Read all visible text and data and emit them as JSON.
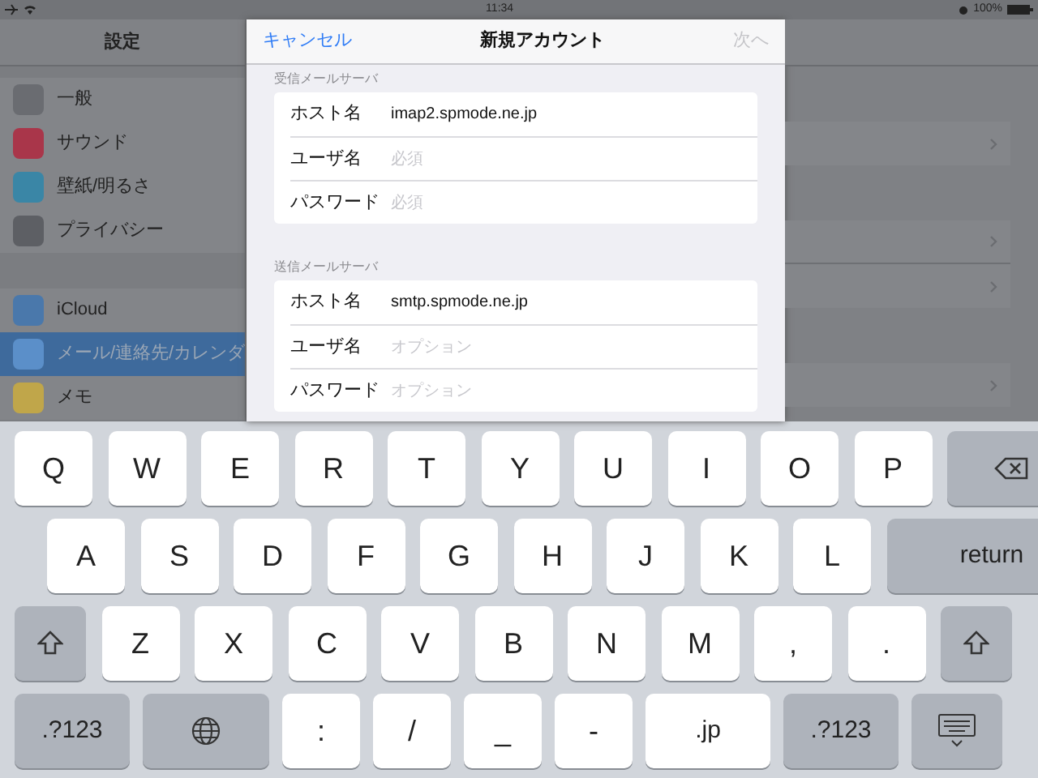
{
  "status_bar": {
    "time": "11:34",
    "battery": "100%"
  },
  "sidebar": {
    "title": "設定",
    "groups": [
      {
        "items": [
          {
            "label": "一般",
            "color": "#6a6c71",
            "selected": false
          },
          {
            "label": "サウンド",
            "color": "#a9364a",
            "selected": false
          },
          {
            "label": "壁紙/明るさ",
            "color": "#3a86a6",
            "selected": false
          },
          {
            "label": "プライバシー",
            "color": "#5d5f64",
            "selected": false
          }
        ]
      },
      {
        "items": [
          {
            "label": "iCloud",
            "color": "#4a78ab",
            "selected": false
          },
          {
            "label": "メール/連絡先/カレンダ",
            "color": "#5b8fc9",
            "selected": true
          },
          {
            "label": "メモ",
            "color": "#c0a64a",
            "selected": false
          }
        ]
      }
    ]
  },
  "dialog": {
    "cancel": "キャンセル",
    "title": "新規アカウント",
    "next": {
      "label": "次へ",
      "disabled": true
    },
    "sections": [
      {
        "header": "受信メールサーバ",
        "rows": [
          {
            "label": "ホスト名",
            "value": "imap2.spmode.ne.jp"
          },
          {
            "label": "ユーザ名",
            "placeholder": "必須"
          },
          {
            "label": "パスワード",
            "placeholder": "必須"
          }
        ]
      },
      {
        "header": "送信メールサーバ",
        "rows": [
          {
            "label": "ホスト名",
            "value": "smtp.spmode.ne.jp"
          },
          {
            "label": "ユーザ名",
            "placeholder": "オプション"
          },
          {
            "label": "パスワード",
            "placeholder": "オプション"
          }
        ]
      }
    ]
  },
  "keyboard": {
    "rows": [
      {
        "keys": [
          {
            "kind": "letter",
            "label": "Q"
          },
          {
            "kind": "letter",
            "label": "W"
          },
          {
            "kind": "letter",
            "label": "E"
          },
          {
            "kind": "letter",
            "label": "R"
          },
          {
            "kind": "letter",
            "label": "T"
          },
          {
            "kind": "letter",
            "label": "Y"
          },
          {
            "kind": "letter",
            "label": "U"
          },
          {
            "kind": "letter",
            "label": "I"
          },
          {
            "kind": "letter",
            "label": "O"
          },
          {
            "kind": "letter",
            "label": "P"
          },
          {
            "kind": "backspace"
          }
        ]
      },
      {
        "keys": [
          {
            "kind": "letter",
            "label": "A"
          },
          {
            "kind": "letter",
            "label": "S"
          },
          {
            "kind": "letter",
            "label": "D"
          },
          {
            "kind": "letter",
            "label": "F"
          },
          {
            "kind": "letter",
            "label": "G"
          },
          {
            "kind": "letter",
            "label": "H"
          },
          {
            "kind": "letter",
            "label": "J"
          },
          {
            "kind": "letter",
            "label": "K"
          },
          {
            "kind": "letter",
            "label": "L"
          },
          {
            "kind": "return",
            "label": "return"
          }
        ]
      },
      {
        "keys": [
          {
            "kind": "shift"
          },
          {
            "kind": "letter",
            "label": "Z"
          },
          {
            "kind": "letter",
            "label": "X"
          },
          {
            "kind": "letter",
            "label": "C"
          },
          {
            "kind": "letter",
            "label": "V"
          },
          {
            "kind": "letter",
            "label": "B"
          },
          {
            "kind": "letter",
            "label": "N"
          },
          {
            "kind": "letter",
            "label": "M"
          },
          {
            "kind": "letter",
            "label": ","
          },
          {
            "kind": "letter",
            "label": "."
          },
          {
            "kind": "shift"
          }
        ]
      },
      {
        "keys": [
          {
            "kind": "mode",
            "label": ".?123"
          },
          {
            "kind": "globe"
          },
          {
            "kind": "letter",
            "label": ":"
          },
          {
            "kind": "letter",
            "label": "/"
          },
          {
            "kind": "letter",
            "label": "_"
          },
          {
            "kind": "letter",
            "label": "-"
          },
          {
            "kind": "domain",
            "label": ".jp"
          },
          {
            "kind": "mode",
            "label": ".?123"
          },
          {
            "kind": "hide"
          }
        ]
      }
    ]
  }
}
